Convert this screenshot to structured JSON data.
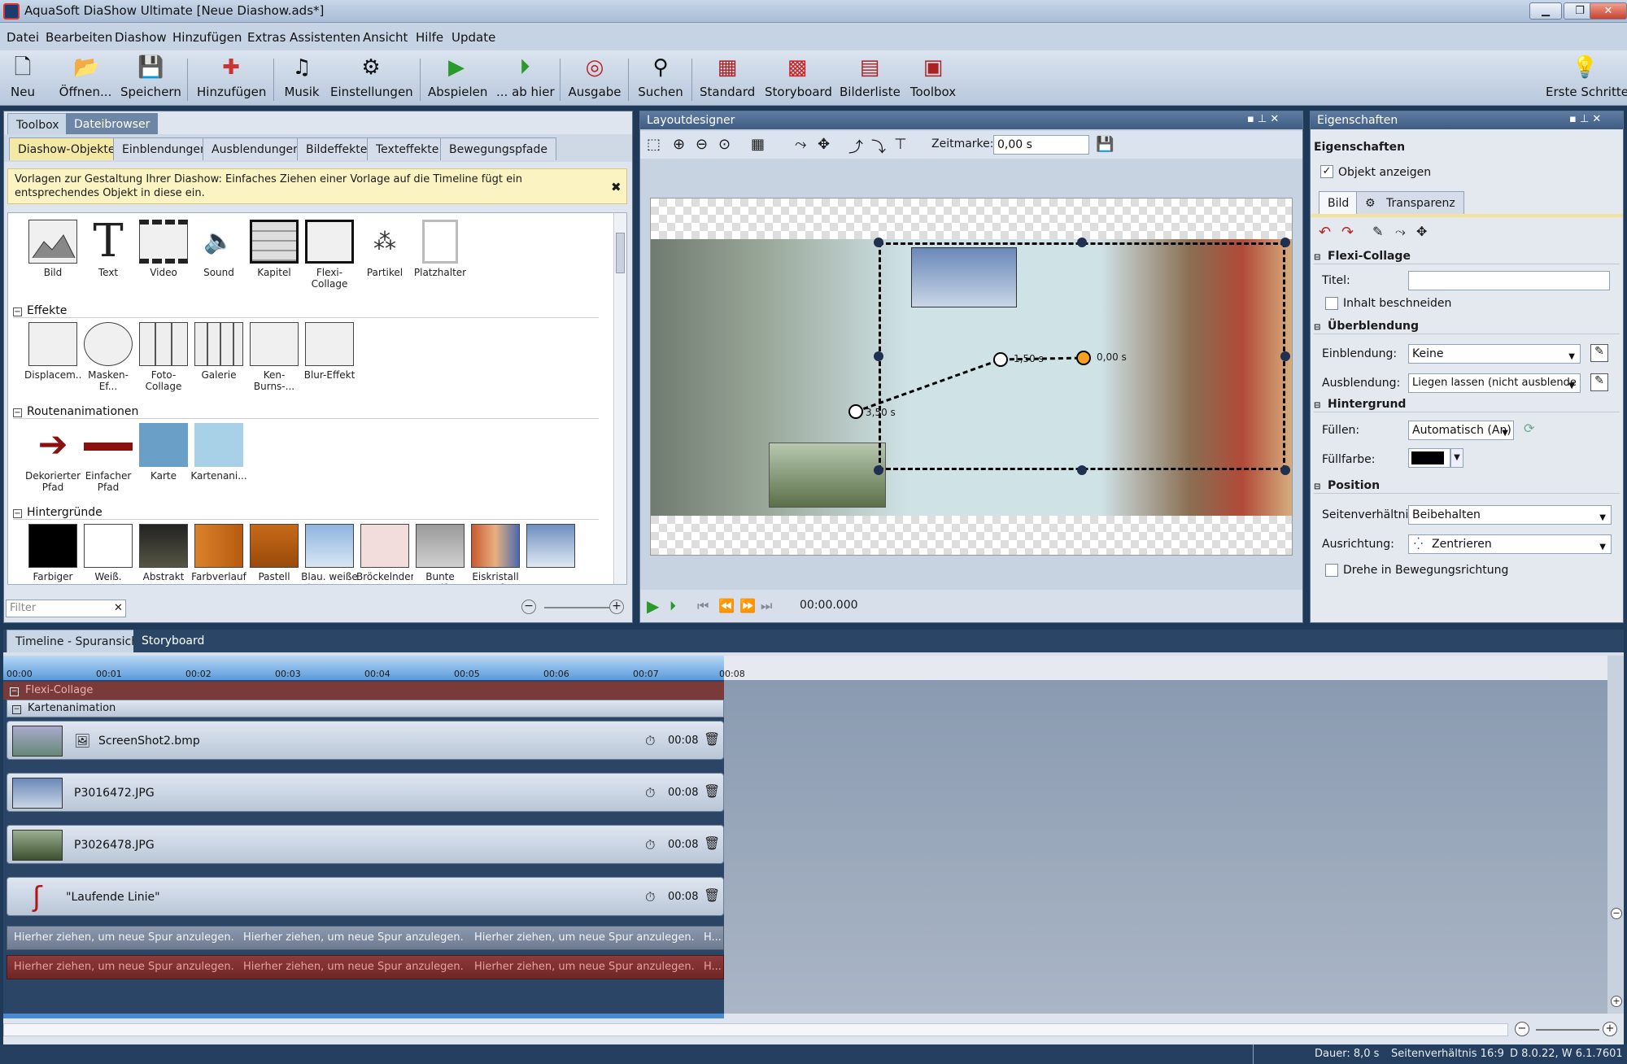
{
  "window": {
    "title": "AquaSoft DiaShow Ultimate [Neue Diashow.ads*]",
    "min": "▁",
    "max": "❐",
    "close": "✕"
  },
  "menu": [
    "Datei",
    "Bearbeiten",
    "Diashow",
    "Hinzufügen",
    "Extras",
    "Assistenten",
    "Ansicht",
    "Hilfe",
    "Update"
  ],
  "toolbar": {
    "neu": "Neu",
    "oeffnen": "Öffnen...",
    "speichern": "Speichern",
    "hinzufuegen": "Hinzufügen",
    "musik": "Musik",
    "einstellungen": "Einstellungen",
    "abspielen": "Abspielen",
    "abhier": "... ab hier",
    "ausgabe": "Ausgabe",
    "suchen": "Suchen",
    "standard": "Standard",
    "storyboard": "Storyboard",
    "bilderliste": "Bilderliste",
    "toolbox": "Toolbox",
    "ersteschritte": "Erste Schritte"
  },
  "toolbox": {
    "tabs": [
      "Toolbox",
      "Dateibrowser"
    ],
    "subtabs": [
      "Diashow-Objekte",
      "Einblendungen",
      "Ausblendungen",
      "Bildeffekte",
      "Texteffekte",
      "Bewegungspfade"
    ],
    "hint": "Vorlagen zur Gestaltung Ihrer Diashow: Einfaches Ziehen einer Vorlage auf die Timeline fügt ein entsprechendes Objekt in diese ein.",
    "close": "✖",
    "objects": [
      "Bild",
      "Text",
      "Video",
      "Sound",
      "Kapitel",
      "Flexi-Collage",
      "Partikel",
      "Platzhalter"
    ],
    "sec_effekte": "Effekte",
    "effekte": [
      "Displacem...",
      "Masken-Ef...",
      "Foto-Collage",
      "Galerie",
      "Ken-Burns-...",
      "Blur-Effekt"
    ],
    "sec_route": "Routenanimationen",
    "route": [
      "Dekorierter Pfad",
      "Einfacher Pfad",
      "Karte",
      "Kartenani..."
    ],
    "sec_hinter": "Hintergründe",
    "hinter": [
      "Farbiger",
      "Weiß.",
      "Abstrakt",
      "Farbverlauf",
      "Pastell",
      "Blau. weiße Blumenvase.",
      "Bröckelnder",
      "Bunte Streifen",
      "Eiskristall auf"
    ],
    "filter_placeholder": "Filter",
    "filter_clear": "✕",
    "minus": "−",
    "plus": "+"
  },
  "layout": {
    "title": "Layoutdesigner",
    "zeitmarke_label": "Zeitmarke:",
    "zeitmarke_value": "0,00 s",
    "times": [
      "1,50 s",
      "0,00 s",
      "3,50 s"
    ],
    "time_display": "00:00.000",
    "pin": "▪ ⊥ ✕"
  },
  "props": {
    "title": "Eigenschaften",
    "heading": "Eigenschaften",
    "objekt_anzeigen": "Objekt anzeigen",
    "tabs": [
      "Bild",
      "Transparenz"
    ],
    "grp_flexi": "Flexi-Collage",
    "titel_label": "Titel:",
    "titel_value": "",
    "inhalt": "Inhalt beschneiden",
    "grp_ueber": "Überblendung",
    "einblendung_label": "Einblendung:",
    "einblendung_value": "Keine",
    "ausblendung_label": "Ausblendung:",
    "ausblendung_value": "Liegen lassen (nicht ausblende",
    "grp_hinter": "Hintergrund",
    "fuellen_label": "Füllen:",
    "fuellen_value": "Automatisch (An)",
    "fuellfarbe_label": "Füllfarbe:",
    "grp_position": "Position",
    "seiten_label": "Seitenverhältnis:",
    "seiten_value": "Beibehalten",
    "ausricht_label": "Ausrichtung:",
    "ausricht_value": "Zentrieren",
    "drehe": "Drehe in Bewegungsrichtung",
    "check": "✓"
  },
  "timeline": {
    "tabs": [
      "Timeline - Spuransicht",
      "Storyboard"
    ],
    "ruler": [
      "00:00",
      "00:01",
      "00:02",
      "00:03",
      "00:04",
      "00:05",
      "00:06",
      "00:07",
      "00:08"
    ],
    "sub": "300",
    "group1": "Flexi-Collage",
    "group2": "Kartenanimation",
    "tracks": [
      {
        "name": "ScreenShot2.bmp",
        "dur": "00:08"
      },
      {
        "name": "P3016472.JPG",
        "dur": "00:08"
      },
      {
        "name": "P3026478.JPG",
        "dur": "00:08"
      },
      {
        "name": "\"Laufende Linie\"",
        "dur": "00:08"
      }
    ],
    "hint": "Hierher ziehen, um neue Spur anzulegen.",
    "hint_end": "H...",
    "minus": "−",
    "plus": "+"
  },
  "status": {
    "dauer": "Dauer: 8,0 s",
    "seiten": "Seitenverhältnis 16:9",
    "version": "D 8.0.22, W 6.1.7601"
  }
}
